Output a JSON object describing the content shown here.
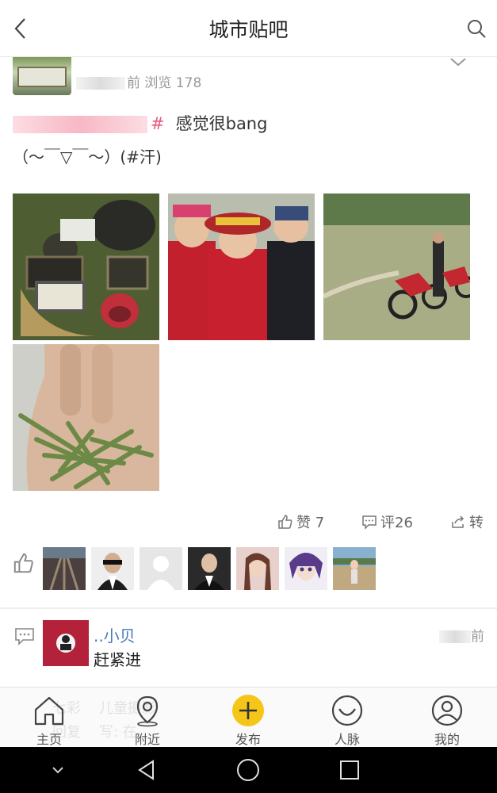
{
  "header": {
    "back_icon": "chevron-left-icon",
    "title": "城市贴吧",
    "search_icon": "search-icon"
  },
  "post": {
    "time_suffix": "前",
    "views": "浏览 178",
    "tag_end": "#",
    "title_text": "感觉很bang",
    "body_text": "（～￣▽￣～）(#汗)"
  },
  "actions": {
    "like_label": "赞 7",
    "comment_label": "评26",
    "share_label": "转"
  },
  "comment": {
    "name": "..小贝",
    "text": "赶紧进",
    "time_suffix": "前"
  },
  "background_item": {
    "line1": "七彩",
    "line1b": "儿童摄影",
    "line2": "回复",
    "line2b": "写: 在"
  },
  "tabbar": {
    "home": "主页",
    "nearby": "附近",
    "post": "发布",
    "network": "人脉",
    "me": "我的"
  },
  "colors": {
    "accent_yellow": "#f5c518",
    "link_blue": "#4a78b8",
    "tag_pink": "#e85a7a"
  }
}
